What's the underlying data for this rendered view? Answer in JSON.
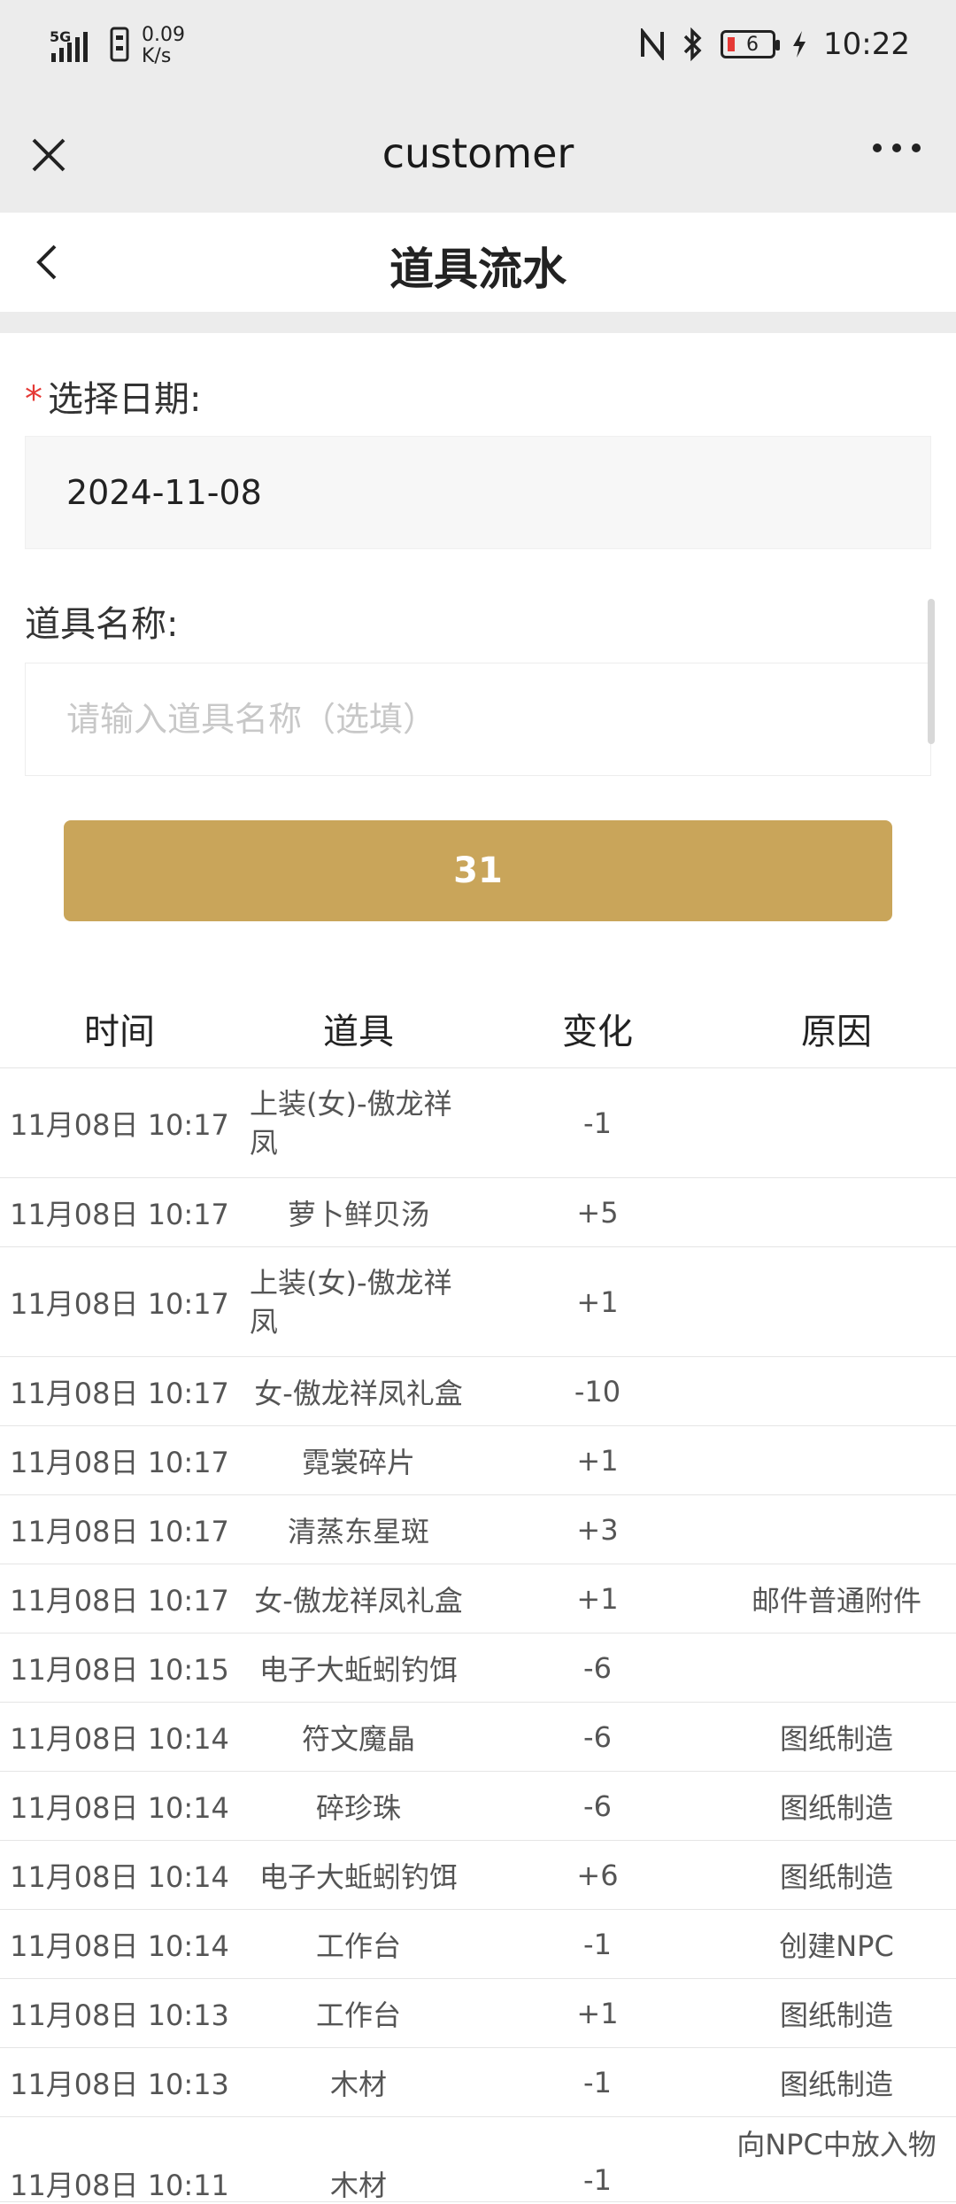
{
  "status_bar": {
    "network": "5G",
    "speed_value": "0.09",
    "speed_unit": "K/s",
    "battery": "6",
    "time": "10:22"
  },
  "title_bar": {
    "title": "customer"
  },
  "page": {
    "title": "道具流水"
  },
  "form": {
    "date_label": "选择日期:",
    "date_required_mark": "*",
    "date_value": "2024-11-08",
    "item_label": "道具名称:",
    "item_placeholder": "请输入道具名称（选填）",
    "submit_label": "31"
  },
  "table": {
    "headers": [
      "时间",
      "道具",
      "变化",
      "原因"
    ],
    "rows": [
      {
        "time": "11月08日 10:17",
        "item": "上装(女)-傲龙祥凤",
        "change": "-1",
        "reason": ""
      },
      {
        "time": "11月08日 10:17",
        "item": "萝卜鲜贝汤",
        "change": "+5",
        "reason": ""
      },
      {
        "time": "11月08日 10:17",
        "item": "上装(女)-傲龙祥凤",
        "change": "+1",
        "reason": ""
      },
      {
        "time": "11月08日 10:17",
        "item": "女-傲龙祥凤礼盒",
        "change": "-10",
        "reason": ""
      },
      {
        "time": "11月08日 10:17",
        "item": "霓裳碎片",
        "change": "+1",
        "reason": ""
      },
      {
        "time": "11月08日 10:17",
        "item": "清蒸东星斑",
        "change": "+3",
        "reason": ""
      },
      {
        "time": "11月08日 10:17",
        "item": "女-傲龙祥凤礼盒",
        "change": "+1",
        "reason": "邮件普通附件"
      },
      {
        "time": "11月08日 10:15",
        "item": "电子大蚯蚓钓饵",
        "change": "-6",
        "reason": ""
      },
      {
        "time": "11月08日 10:14",
        "item": "符文魔晶",
        "change": "-6",
        "reason": "图纸制造"
      },
      {
        "time": "11月08日 10:14",
        "item": "碎珍珠",
        "change": "-6",
        "reason": "图纸制造"
      },
      {
        "time": "11月08日 10:14",
        "item": "电子大蚯蚓钓饵",
        "change": "+6",
        "reason": "图纸制造"
      },
      {
        "time": "11月08日 10:14",
        "item": "工作台",
        "change": "-1",
        "reason": "创建NPC"
      },
      {
        "time": "11月08日 10:13",
        "item": "工作台",
        "change": "+1",
        "reason": "图纸制造"
      },
      {
        "time": "11月08日 10:13",
        "item": "木材",
        "change": "-1",
        "reason": "图纸制造"
      },
      {
        "time": "11月08日 10:11",
        "item": "木材",
        "change": "-1",
        "reason": "向NPC中放入物"
      }
    ]
  }
}
